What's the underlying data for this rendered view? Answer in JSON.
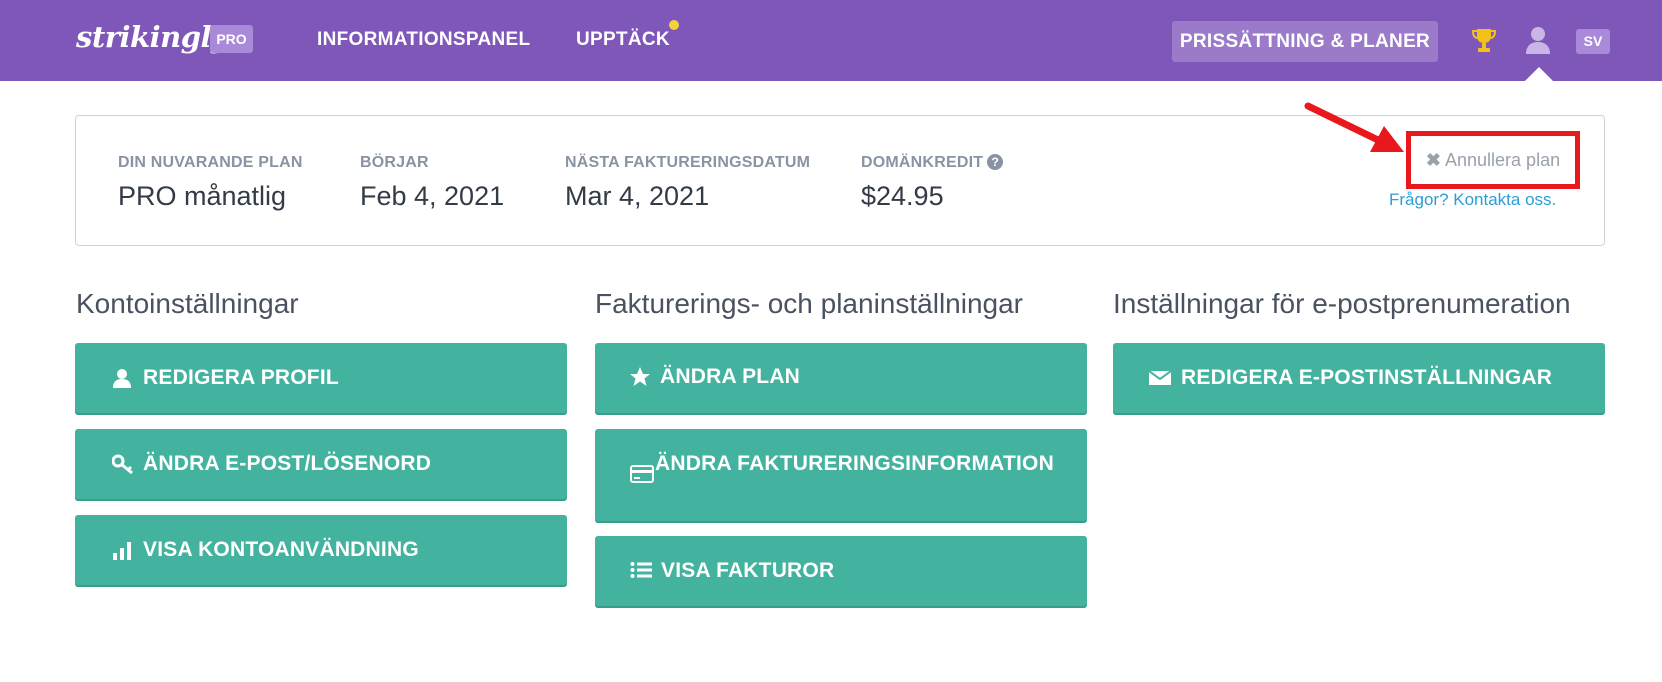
{
  "nav": {
    "logo": "strikingly",
    "logo_badge": "PRO",
    "links": [
      "INFORMATIONSPANEL",
      "UPPTÄCK"
    ],
    "pricing": "PRISSÄTTNING & PLANER",
    "lang": "SV",
    "icons": [
      "trophy-icon",
      "user-icon"
    ]
  },
  "plan": {
    "current_label": "DIN NUVARANDE PLAN",
    "current_value": "PRO månatlig",
    "start_label": "BÖRJAR",
    "start_value": "Feb 4, 2021",
    "next_label": "NÄSTA FAKTURERINGSDATUM",
    "next_value": "Mar 4, 2021",
    "credit_label": "DOMÄNKREDIT",
    "credit_value": "$24.95",
    "cancel": "Annullera plan",
    "contact": "Frågor? Kontakta oss."
  },
  "sections": {
    "account": {
      "title": "Kontoinställningar",
      "buttons": [
        "REDIGERA PROFIL",
        "ÄNDRA E-POST/LÖSENORD",
        "VISA KONTOANVÄNDNING"
      ]
    },
    "billing": {
      "title": "Fakturerings- och planinställningar",
      "buttons": [
        "ÄNDRA PLAN",
        "ÄNDRA FAKTURERINGSINFORMATION",
        "VISA FAKTUROR"
      ]
    },
    "email": {
      "title": "Inställningar för e-postprenumeration",
      "buttons": [
        "REDIGERA E-POSTINSTÄLLNINGAR"
      ]
    }
  },
  "colors": {
    "nav_bg": "#7e57b8",
    "button_bg": "#43b3a0",
    "highlight": "#e8181c",
    "link": "#2b9fd8"
  }
}
